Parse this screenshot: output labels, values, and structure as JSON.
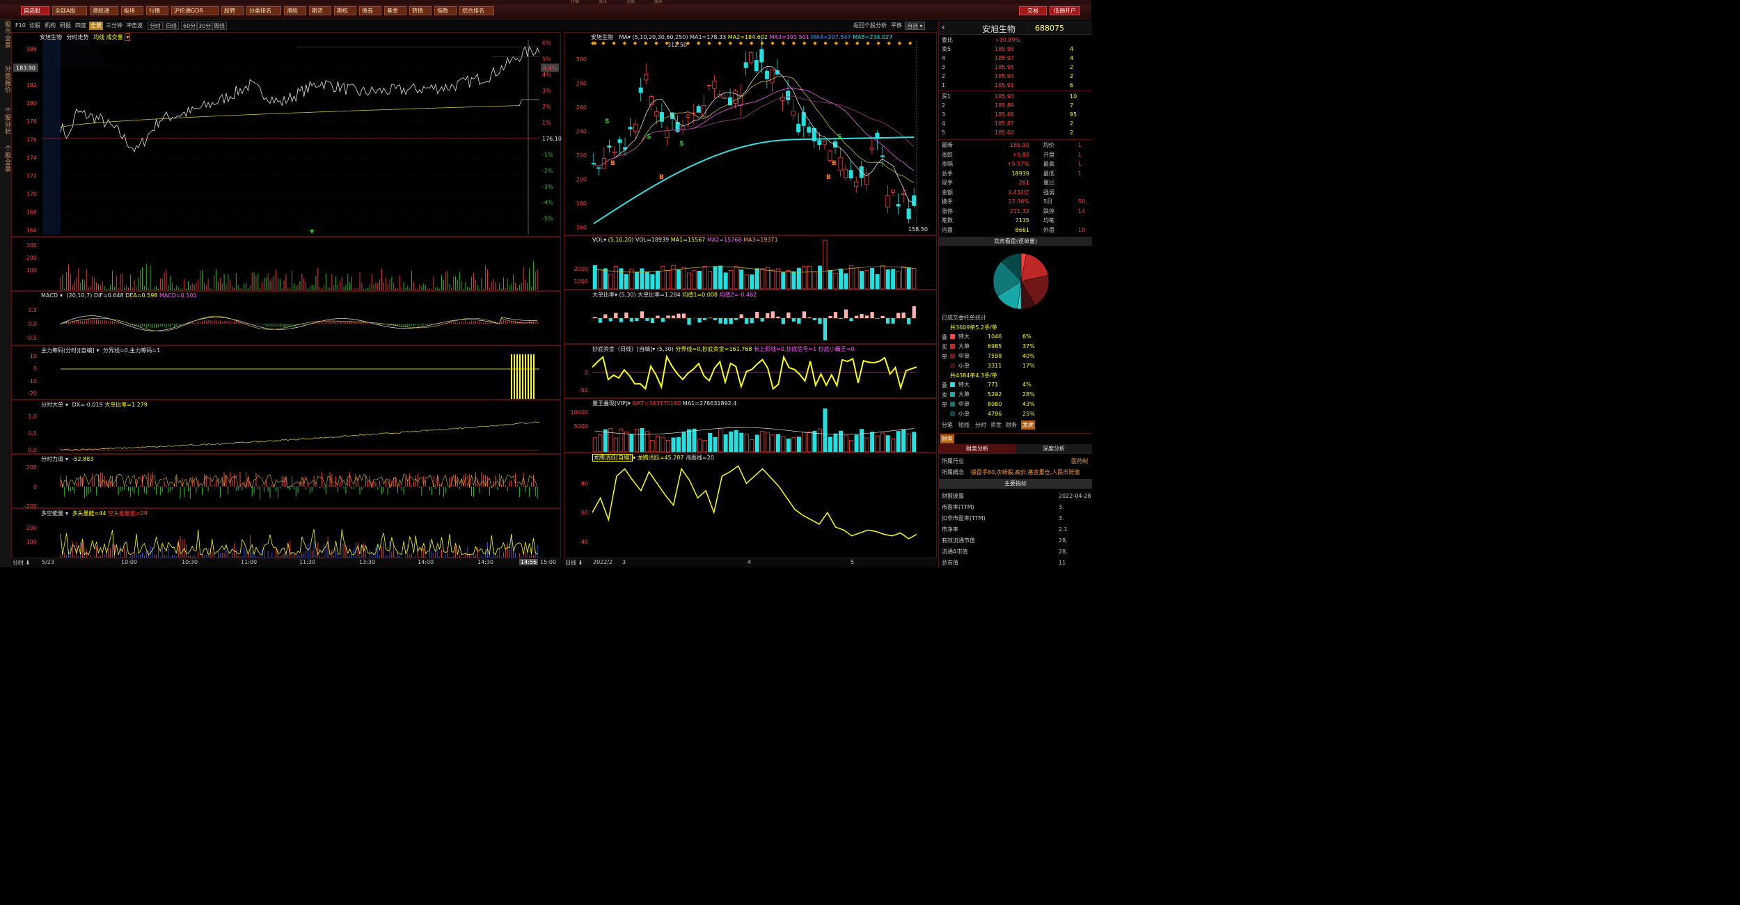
{
  "window_tabs": [
    "行情",
    "资讯",
    "交易",
    "服务"
  ],
  "toolbar": {
    "items": [
      "自选股",
      "全部A股",
      "港股通",
      "板块",
      "行情",
      "沪伦通GDR",
      "股转",
      "分类排名",
      "港股",
      "期货",
      "期权",
      "债券",
      "基金",
      "转债",
      "指数",
      "综合排名"
    ],
    "trade_label": "交易",
    "open_account_label": "低佣开户"
  },
  "left_tabs": [
    "股市全景",
    "分类报价",
    "个股分析",
    "个股全景"
  ],
  "subtabs": [
    "F10",
    "诊股",
    "机构",
    "研报",
    "四度",
    "全景",
    "三分钟",
    "冲击波"
  ],
  "period_tabs": [
    "分时",
    "日线",
    "60分",
    "30分",
    "周线"
  ],
  "right_top_links": {
    "back": "返回个股分析",
    "flat": "平移",
    "selfsel": "自选"
  },
  "intraday": {
    "title": "安旭生物",
    "subtitle": "分时走势",
    "legend": "均线 成交量",
    "price_ticks": [
      "186",
      "184",
      "182",
      "180",
      "178",
      "176",
      "174",
      "172",
      "170",
      "168",
      "166"
    ],
    "pct_ticks": [
      "6%",
      "5%",
      "4%",
      "3%",
      "2%",
      "1%",
      "",
      "-1%",
      "-2%",
      "-3%",
      "-4%",
      "-5%"
    ],
    "cur_price": "183.90",
    "cur_pct": "4.4%",
    "pre_close": "176.10",
    "time_ticks": [
      "5/23",
      "10:00",
      "10:30",
      "11:00",
      "11:30",
      "13:30",
      "14:00",
      "14:30",
      "14:56",
      "15:00"
    ],
    "time_label": "分时"
  },
  "macd": {
    "title": "MACD",
    "params": "(20,10,7)",
    "dif": "DIF=0.648",
    "dea": "DEA=0.598",
    "macd": "MACD=0.101",
    "ticks": [
      "0.5",
      "0.0",
      "-0.5"
    ]
  },
  "main_chip": {
    "title": "主力筹码(分时)[自编]",
    "info": "分界线=0,主力筹码=1",
    "ticks": [
      "10",
      "0",
      "-10",
      "-20"
    ]
  },
  "big_order": {
    "title": "分时大单",
    "dx": "DX=-0.019",
    "ratio": "大单比率=1.279",
    "ticks": [
      "1.0",
      "0.5",
      "0.0"
    ]
  },
  "force": {
    "title": "分时力道",
    "val": "-52.883",
    "ticks": [
      "200",
      "0",
      "-200"
    ]
  },
  "long_short": {
    "title": "多空能量",
    "val": "多头量能=44",
    "val2": "空头能量能=29",
    "ticks": [
      "200",
      "100"
    ]
  },
  "daily": {
    "title": "安旭生物",
    "ma_label": "MA",
    "params": "(5,10,20,30,60,250)",
    "ma1": "MA1=178.33",
    "ma2": "MA2=184.602",
    "ma3": "MA3=191.501",
    "ma4": "MA4=207.547",
    "ma5": "MA5=234.027",
    "ticks": [
      "300",
      "280",
      "260",
      "240",
      "220",
      "200",
      "180",
      "160"
    ],
    "high": "312.50",
    "low": "158.50",
    "dates": [
      "2022/2",
      "3",
      "4",
      "5"
    ],
    "date_label": "日线"
  },
  "vol": {
    "title": "VOL",
    "params": "(5,10,20)",
    "vol": "VOL=18939",
    "ma1": "MA1=15567",
    "ma2": "MA2=15768",
    "ma3": "MA3=19371",
    "ticks": [
      "2000",
      "1000"
    ]
  },
  "big_ratio": {
    "title": "大单比率",
    "params": "(5,30)",
    "v": "大单比率=1.284",
    "j1": "均值1=0.008",
    "j2": "均值2=-0.462"
  },
  "bottom_fund": {
    "title": "抄底资金（日线）[自编]",
    "params": "(5,30)",
    "info": "分界线=0,抄底资金=161.768",
    "info2": "长上影线=0,抄底信号=1",
    "info3": "抄底小霸王=0"
  },
  "vol_king": {
    "title": "量王叠现[VIP]",
    "amt": "AMT=343170160",
    "ma1": "MA1=276631892.4",
    "ticks": [
      "10000",
      "5000"
    ]
  },
  "dragon": {
    "title": "龙腾活跃[自编]",
    "v": "龙腾活跃=45.287",
    "sea": "海面线=20",
    "ticks": [
      "80",
      "60",
      "40"
    ]
  },
  "quote": {
    "name": "安旭生物",
    "code": "688075",
    "ratio_label": "委比",
    "ratio": "+10.89%",
    "sells": [
      {
        "l": "卖5",
        "p": "185.98",
        "v": "4"
      },
      {
        "l": "4",
        "p": "185.97",
        "v": "4"
      },
      {
        "l": "3",
        "p": "185.95",
        "v": "2"
      },
      {
        "l": "2",
        "p": "185.94",
        "v": "2"
      },
      {
        "l": "1",
        "p": "185.91",
        "v": "6"
      }
    ],
    "buys": [
      {
        "l": "买1",
        "p": "185.90",
        "v": "10"
      },
      {
        "l": "2",
        "p": "185.89",
        "v": "7"
      },
      {
        "l": "3",
        "p": "185.88",
        "v": "95"
      },
      {
        "l": "4",
        "p": "185.87",
        "v": "2"
      },
      {
        "l": "5",
        "p": "185.60",
        "v": "2"
      }
    ],
    "stats": [
      {
        "k": "最新",
        "v": "185.90",
        "k2": "均价",
        "v2": "1"
      },
      {
        "k": "涨跌",
        "v": "+9.80",
        "k2": "开盘",
        "v2": "1"
      },
      {
        "k": "涨幅",
        "v": "+5.57%",
        "k2": "最高",
        "v2": "1"
      },
      {
        "k": "总手",
        "v": "18939",
        "k2": "最低",
        "v2": "1"
      },
      {
        "k": "现手",
        "v": "261",
        "k2": "量比",
        "v2": ""
      },
      {
        "k": "金额",
        "v": "3.432亿",
        "k2": "强弱",
        "v2": ""
      },
      {
        "k": "换手",
        "v": "12.36%",
        "k2": "5日",
        "v2": "50."
      },
      {
        "k": "涨停",
        "v": "211.32",
        "k2": "跌停",
        "v2": "14"
      },
      {
        "k": "笔数",
        "v": "7135",
        "k2": "均笔",
        "v2": ""
      },
      {
        "k": "内盘",
        "v": "8661",
        "k2": "外盘",
        "v2": "10"
      }
    ]
  },
  "dragon_pie": {
    "title": "龙虎看盘(逐单量)",
    "caption": "已成交委托单统计",
    "slices": [
      {
        "value": 6,
        "color": "#ff4040"
      },
      {
        "value": 37,
        "color": "#c02828"
      },
      {
        "value": 40,
        "color": "#701818"
      },
      {
        "value": 17,
        "color": "#401010"
      },
      {
        "value": 4,
        "color": "#20e0e0"
      },
      {
        "value": 28,
        "color": "#18a8a8"
      },
      {
        "value": 43,
        "color": "#107878"
      },
      {
        "value": 25,
        "color": "#084848"
      }
    ]
  },
  "buy_stats": {
    "head": "共3609单5.2手/单",
    "side": [
      "委",
      "买",
      "单"
    ],
    "rows": [
      {
        "n": "特大",
        "a": "1046",
        "p": "6%"
      },
      {
        "n": "大单",
        "a": "6985",
        "p": "37%"
      },
      {
        "n": "中单",
        "a": "7598",
        "p": "40%"
      },
      {
        "n": "小单",
        "a": "3311",
        "p": "17%"
      }
    ]
  },
  "sell_stats": {
    "head": "共4384单4.3手/单",
    "side": [
      "委",
      "卖",
      "单"
    ],
    "rows": [
      {
        "n": "特大",
        "a": "771",
        "p": "4%"
      },
      {
        "n": "大单",
        "a": "5292",
        "p": "28%"
      },
      {
        "n": "中单",
        "a": "8080",
        "p": "43%"
      },
      {
        "n": "小单",
        "a": "4796",
        "p": "25%"
      }
    ]
  },
  "bottom_tabs": [
    "分笔",
    "短线",
    "分时",
    "资金",
    "财务",
    "龙虎"
  ],
  "fin": {
    "tab": "财务",
    "sub1": "财务分析",
    "sub2": "深度分析",
    "industry_k": "所属行业",
    "industry_v": "医药制",
    "concept_k": "所属概念",
    "concept_v": "操盘手80,次新股,高价,基金重仓,人民币贬值",
    "main_idx": "主要指标",
    "rows": [
      {
        "k": "财报披露",
        "v": "2022-04-28"
      },
      {
        "k": "市盈率(TTM)",
        "v": "3."
      },
      {
        "k": "扣非市盈率(TTM)",
        "v": "3."
      },
      {
        "k": "市净率",
        "v": "2.1"
      },
      {
        "k": "有效流通市值",
        "v": "28."
      },
      {
        "k": "流通A市值",
        "v": "28."
      },
      {
        "k": "总市值",
        "v": "11"
      }
    ]
  }
}
